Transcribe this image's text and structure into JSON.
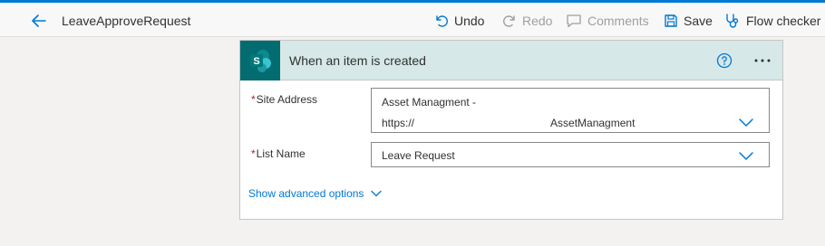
{
  "header": {
    "flow_title": "LeaveApproveRequest",
    "undo_label": "Undo",
    "redo_label": "Redo",
    "comments_label": "Comments",
    "save_label": "Save",
    "flow_checker_label": "Flow checker"
  },
  "trigger": {
    "title": "When an item is created",
    "icon": "sharepoint-icon",
    "icon_letter": "S"
  },
  "fields": {
    "site_address": {
      "label": "Site Address",
      "required_marker": "*",
      "value_line1": "Asset Managment -",
      "value_line2_prefix": "https://",
      "value_line2_suffix": "AssetManagment"
    },
    "list_name": {
      "label": "List Name",
      "required_marker": "*",
      "value": "Leave Request"
    }
  },
  "advanced": {
    "label": "Show advanced options"
  },
  "colors": {
    "accent": "#0078d4",
    "sharepoint": "#036c70",
    "card_header": "#d6e8e8",
    "required": "#a4262c"
  }
}
